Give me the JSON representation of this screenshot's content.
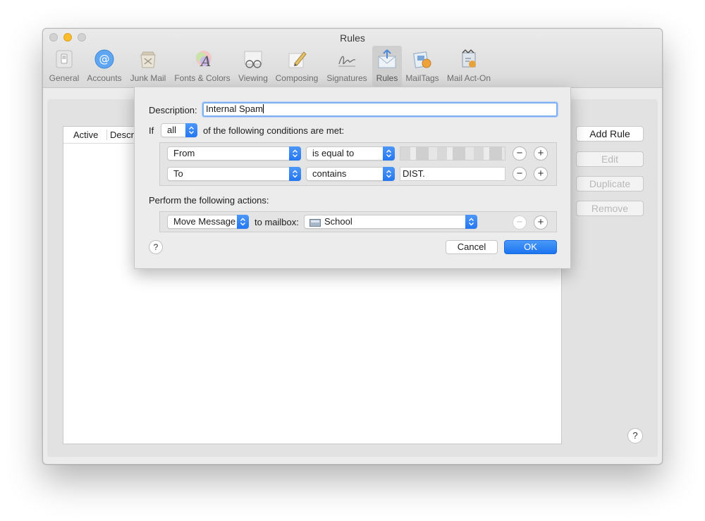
{
  "window": {
    "title": "Rules"
  },
  "toolbar": [
    {
      "label": "General",
      "icon": "switch-icon"
    },
    {
      "label": "Accounts",
      "icon": "at-sign-icon"
    },
    {
      "label": "Junk Mail",
      "icon": "junk-bin-icon"
    },
    {
      "label": "Fonts & Colors",
      "icon": "fonts-colors-icon"
    },
    {
      "label": "Viewing",
      "icon": "glasses-icon"
    },
    {
      "label": "Composing",
      "icon": "pencil-icon"
    },
    {
      "label": "Signatures",
      "icon": "signature-icon"
    },
    {
      "label": "Rules",
      "icon": "rules-envelope-icon",
      "active": true
    },
    {
      "label": "MailTags",
      "icon": "mailtags-icon"
    },
    {
      "label": "Mail Act-On",
      "icon": "mail-act-on-icon"
    }
  ],
  "table": {
    "col_active": "Active",
    "col_description": "Descri"
  },
  "side_buttons": {
    "add_rule": "Add Rule",
    "edit": "Edit",
    "duplicate": "Duplicate",
    "remove": "Remove"
  },
  "sheet": {
    "description_label": "Description:",
    "description_value": "Internal Spam",
    "if_label": "If",
    "match_select": "all",
    "conditions_text": "of the following conditions are met:",
    "conditions": [
      {
        "field": "From",
        "operator": "is equal to",
        "value": ""
      },
      {
        "field": "To",
        "operator": "contains",
        "value": "DIST."
      }
    ],
    "actions_label": "Perform the following actions:",
    "action": {
      "type": "Move Message",
      "to_label": "to mailbox:",
      "mailbox": "School"
    },
    "help": "?",
    "cancel": "Cancel",
    "ok": "OK"
  },
  "window_help": "?",
  "colors": {
    "accent": "#2477f2",
    "focus_ring": "#7fb1f2",
    "minimize": "#fdbc2e"
  }
}
